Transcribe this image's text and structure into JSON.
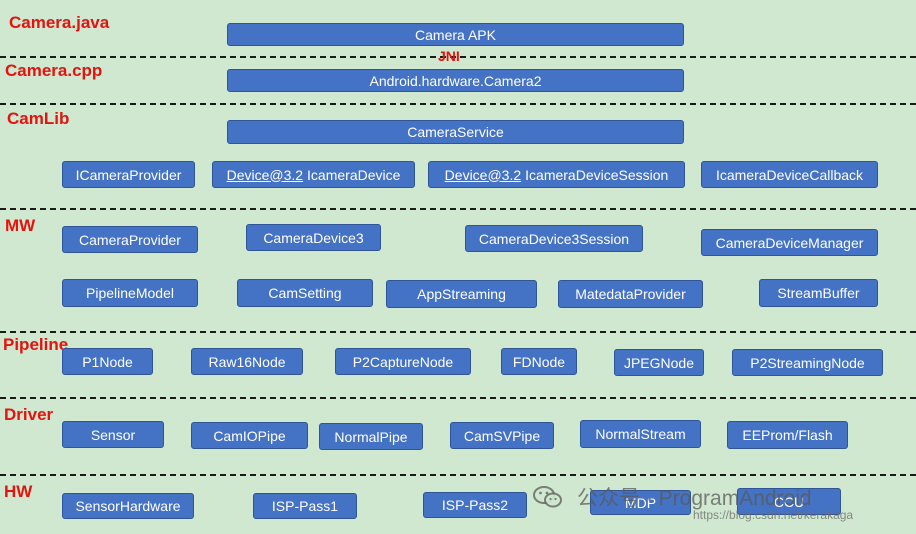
{
  "layers": {
    "java": "Camera.java",
    "cpp": "Camera.cpp",
    "camlib": "CamLib",
    "mw": "MW",
    "pipeline": "Pipeline",
    "driver": "Driver",
    "hw": "HW"
  },
  "jni": "JNI",
  "boxes": {
    "camera_apk": "Camera APK",
    "android_camera2": "Android.hardware.Camera2",
    "camera_service": "CameraService",
    "icamera_provider": "ICameraProvider",
    "device_prefix": "Device@3.2",
    "icamera_device": "IcameraDevice",
    "icamera_device_session": "IcameraDeviceSession",
    "icamera_device_callback": "IcameraDeviceCallback",
    "camera_provider": "CameraProvider",
    "camera_device3": "CameraDevice3",
    "camera_device3_session": "CameraDevice3Session",
    "camera_device_manager": "CameraDeviceManager",
    "pipeline_model": "PipelineModel",
    "cam_setting": "CamSetting",
    "app_streaming": "AppStreaming",
    "matedata_provider": "MatedataProvider",
    "stream_buffer": "StreamBuffer",
    "p1_node": "P1Node",
    "raw16_node": "Raw16Node",
    "p2_capture_node": "P2CaptureNode",
    "fd_node": "FDNode",
    "jpeg_node": "JPEGNode",
    "p2_streaming_node": "P2StreamingNode",
    "sensor": "Sensor",
    "cam_io_pipe": "CamIOPipe",
    "normal_pipe": "NormalPipe",
    "cam_sv_pipe": "CamSVPipe",
    "normal_stream": "NormalStream",
    "eeprom_flash": "EEProm/Flash",
    "sensor_hardware": "SensorHardware",
    "isp_pass1": "ISP-Pass1",
    "isp_pass2": "ISP-Pass2",
    "mdp": "MDP",
    "ccu": "CCU"
  },
  "watermark": {
    "text": "公众号 · ProgramAndroid",
    "url": "https://blog.csdn.net/kerakaga"
  },
  "colors": {
    "background": "#cfe8cf",
    "box": "#4472c4",
    "layer_label": "#e3140f"
  }
}
